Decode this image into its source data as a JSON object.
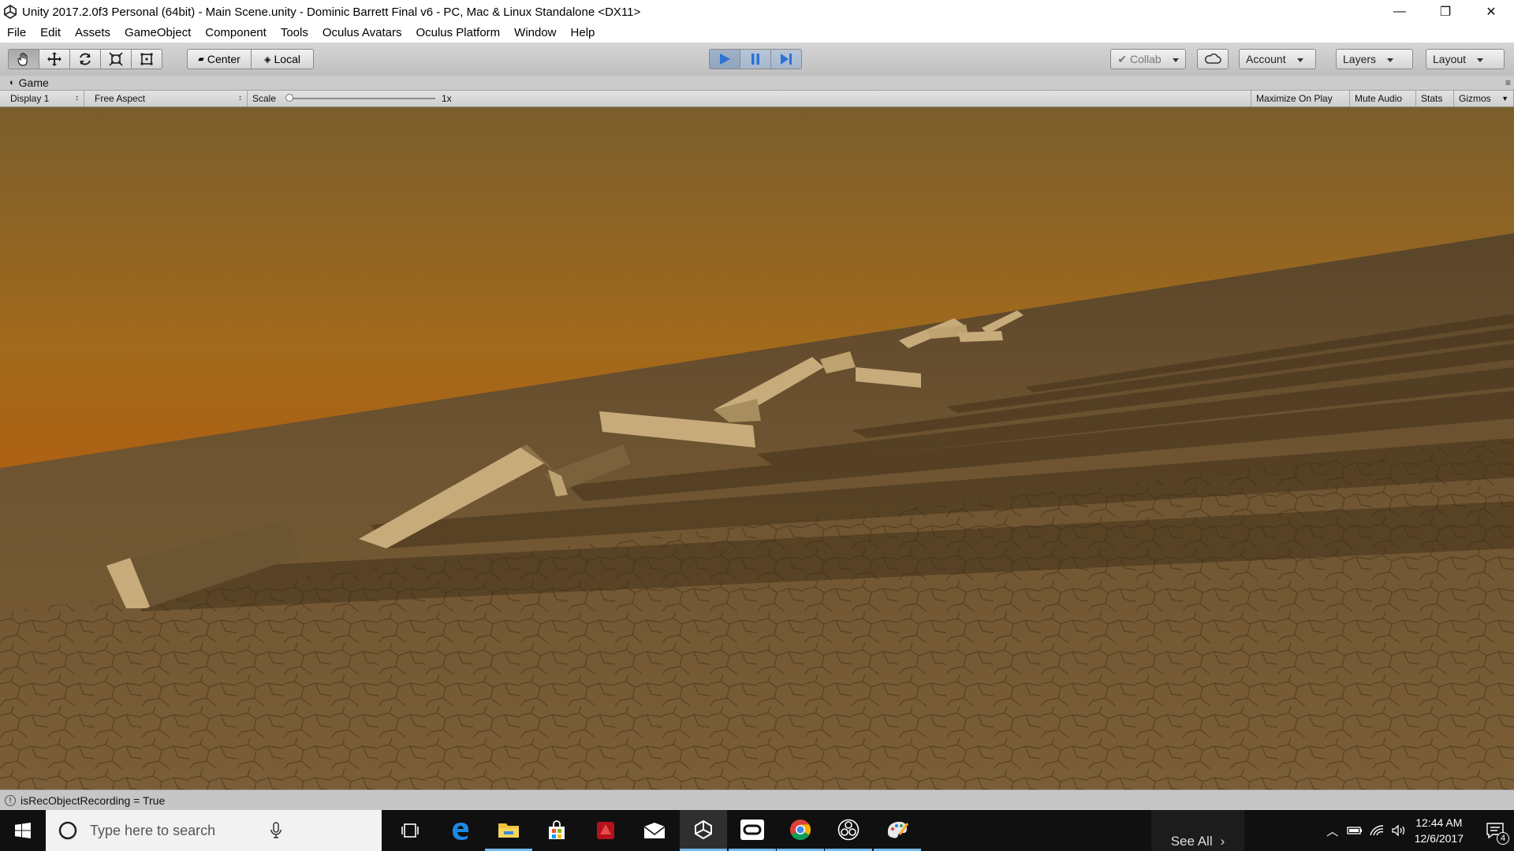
{
  "window": {
    "title": "Unity 2017.2.0f3 Personal (64bit) - Main Scene.unity - Dominic Barrett Final v6 - PC, Mac & Linux Standalone <DX11>",
    "minimize_glyph": "—",
    "restore_glyph": "❐",
    "close_glyph": "✕"
  },
  "menu": [
    "File",
    "Edit",
    "Assets",
    "GameObject",
    "Component",
    "Tools",
    "Oculus Avatars",
    "Oculus Platform",
    "Window",
    "Help"
  ],
  "toolbar": {
    "tools": [
      "hand-icon",
      "move-icon",
      "rotate-icon",
      "scale-icon",
      "rect-icon"
    ],
    "active_tool": "hand-icon",
    "pivot_label": "Center",
    "space_label": "Local",
    "collab_label": "Collab",
    "account_label": "Account",
    "layers_label": "Layers",
    "layout_label": "Layout",
    "play_color": "#2e72d6"
  },
  "game": {
    "tab_label": "Game",
    "display_label": "Display 1",
    "aspect_label": "Free Aspect",
    "scale_label": "Scale",
    "scale_value": "1x",
    "maximize_label": "Maximize On Play",
    "mute_label": "Mute Audio",
    "stats_label": "Stats",
    "gizmos_label": "Gizmos"
  },
  "status": {
    "message": "isRecObjectRecording = True"
  },
  "taskbar": {
    "search_placeholder": "Type here to search",
    "see_all": "See All",
    "time": "12:44 AM",
    "date": "12/6/2017",
    "notification_count": "4",
    "apps": [
      "task-view-icon",
      "edge-icon",
      "file-explorer-icon",
      "store-icon",
      "red-app-icon",
      "mail-icon",
      "unity-icon",
      "oculus-icon",
      "chrome-icon",
      "obs-icon",
      "paint-icon"
    ]
  }
}
